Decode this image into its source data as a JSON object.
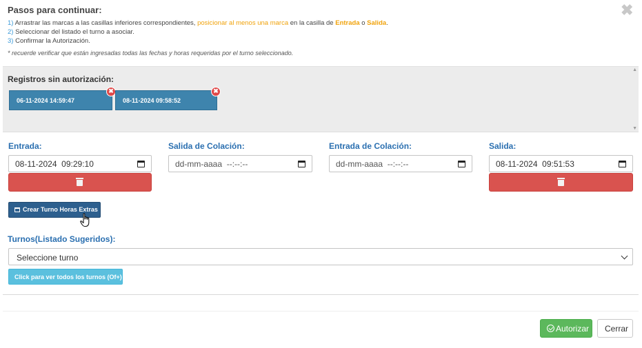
{
  "dialog": {
    "title": "Pasos para continuar:",
    "close_glyph": "✖"
  },
  "steps": {
    "s1_num": "1)",
    "s1_a": " Arrastrar las marcas a las casillas inferiores correspondientes, ",
    "s1_b": "posicionar al menos una marca",
    "s1_c": " en la casilla de ",
    "s1_d": "Entrada",
    "s1_e": " o ",
    "s1_f": "Salida",
    "s1_g": ".",
    "s2_num": "2)",
    "s2_text": " Seleccionar del listado el turno a asociar.",
    "s3_num": "3)",
    "s3_text": " Confirmar la Autorización.",
    "note": "* recuerde verificar que están ingresadas todas las fechas y horas requeridas por el turno seleccionado."
  },
  "records": {
    "title": "Registros sin autorización:",
    "items": [
      {
        "label": "06-11-2024 14:59:47"
      },
      {
        "label": "08-11-2024 09:58:52"
      }
    ],
    "remove_glyph": "✖"
  },
  "fields": {
    "entrada": {
      "label": "Entrada:",
      "value": "08-11-2024  09:29:10"
    },
    "salida_colacion": {
      "label": "Salida de Colación:",
      "value": "dd-mm-aaaa  --:--:--"
    },
    "entrada_colacion": {
      "label": "Entrada de Colación:",
      "value": "dd-mm-aaaa  --:--:--"
    },
    "salida": {
      "label": "Salida:",
      "value": "08-11-2024  09:51:53"
    }
  },
  "overtime_button": "Crear Turno Horas Extras",
  "shifts": {
    "label": "Turnos(Listado Sugeridos):",
    "selected": "Seleccione turno",
    "show_all_button": "Click para ver todos los turnos (Of+)"
  },
  "footer": {
    "authorize": "Autorizar",
    "close": "Cerrar"
  },
  "colors": {
    "primary": "#2d5f8e",
    "chip": "#3e84ad",
    "danger": "#d9534f",
    "success": "#5cb85c",
    "info": "#5bc0de",
    "highlight": "#f0a20a",
    "label": "#2a6fb0"
  }
}
